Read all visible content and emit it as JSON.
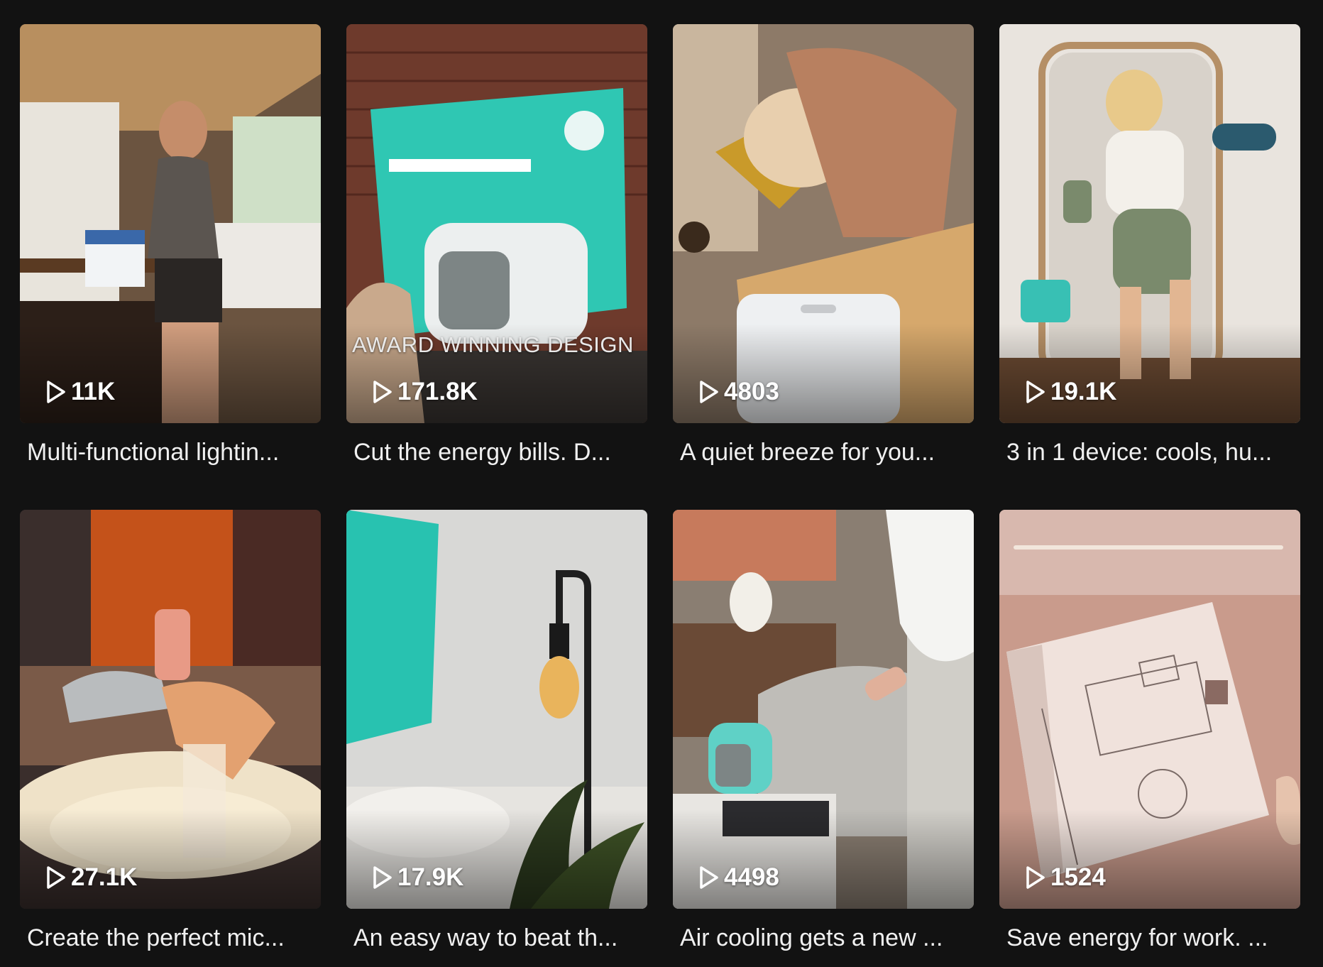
{
  "videos": [
    {
      "views": "11K",
      "caption": "Multi-functional lightin...",
      "overlay_text": "",
      "colors": [
        "#8a6a4a",
        "#d9c7a8",
        "#3a2a22"
      ]
    },
    {
      "views": "171.8K",
      "caption": "Cut the energy bills. D...",
      "overlay_text": "AWARD WINNING DESIGN",
      "colors": [
        "#7a3b2c",
        "#2fc7b3",
        "#e9ecec"
      ]
    },
    {
      "views": "4803",
      "caption": "A quiet breeze for you...",
      "overlay_text": "",
      "colors": [
        "#b58a5a",
        "#d8b07a",
        "#eef0f2"
      ]
    },
    {
      "views": "19.1K",
      "caption": "3 in 1 device: cools, hu...",
      "overlay_text": "",
      "colors": [
        "#ede8e2",
        "#7c8a70",
        "#5a3e2a"
      ]
    },
    {
      "views": "27.1K",
      "caption": "Create the perfect mic...",
      "overlay_text": "",
      "colors": [
        "#c4521a",
        "#efe2c8",
        "#3d2a26"
      ]
    },
    {
      "views": "17.9K",
      "caption": "An easy way to beat th...",
      "overlay_text": "",
      "colors": [
        "#d8d8d6",
        "#28c2b0",
        "#2c3a1e"
      ]
    },
    {
      "views": "4498",
      "caption": "Air cooling gets a new ...",
      "overlay_text": "",
      "colors": [
        "#6a4a36",
        "#bfbdb8",
        "#5fd1c6"
      ]
    },
    {
      "views": "1524",
      "caption": "Save energy for work. ...",
      "overlay_text": "",
      "colors": [
        "#f2c4cc",
        "#e8d4d4",
        "#b57b6e"
      ]
    }
  ],
  "icons": {
    "play": "play-icon"
  }
}
